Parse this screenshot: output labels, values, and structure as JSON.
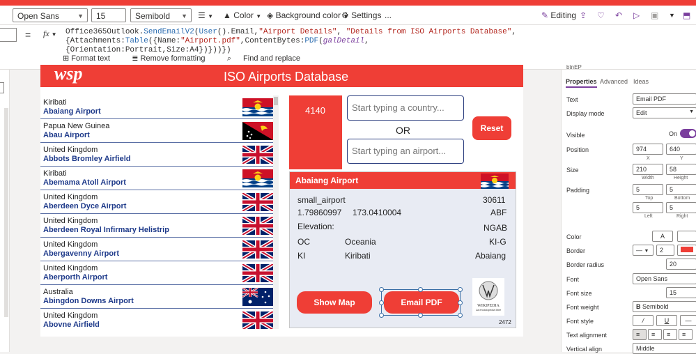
{
  "toolbar": {
    "font": "Open Sans",
    "font_size": "15",
    "font_weight": "Semibold",
    "color_label": "Color",
    "bg_color_label": "Background color",
    "settings_label": "Settings",
    "more_label": "...",
    "editing_label": "Editing"
  },
  "formula": {
    "prop": "=",
    "fx": "fx",
    "p1": "Office365Outlook.",
    "f1": "SendEmailV2",
    "p2": "(",
    "f2": "User",
    "p3": "().Email,",
    "s1": "\"Airport Details\"",
    "p4": ", ",
    "s2": "\"Details from ISO Airports Database\"",
    "p5": ",{Attachments:",
    "f3": "Table",
    "p6": "({Name:",
    "s3": "\"Airport.pdf\"",
    "p7": ",ContentBytes:",
    "f4": "PDF",
    "p8": "(",
    "i1": "galDetail",
    "p9": ",",
    "line2": "{Orientation:Portrait,Size:A4})}))})",
    "format_text": "Format text",
    "remove_formatting": "Remove formatting",
    "find_replace": "Find and replace"
  },
  "app": {
    "title": "ISO Airports Database",
    "logo": "wsp",
    "count": "4140",
    "country_placeholder": "Start typing a country...",
    "or_label": "OR",
    "airport_placeholder": "Start typing an airport...",
    "reset_label": "Reset"
  },
  "airports": [
    {
      "country": "Kiribati",
      "name": "Abaiang Airport",
      "flag": "kiribati-flag"
    },
    {
      "country": "Papua New Guinea",
      "name": "Abau Airport",
      "flag": "png-flag"
    },
    {
      "country": "United Kingdom",
      "name": "Abbots Bromley Airfield",
      "flag": "uk-flag"
    },
    {
      "country": "Kiribati",
      "name": "Abemama Atoll Airport",
      "flag": "kiribati-flag"
    },
    {
      "country": "United Kingdom",
      "name": "Aberdeen Dyce Airport",
      "flag": "uk-flag"
    },
    {
      "country": "United Kingdom",
      "name": "Aberdeen Royal Infirmary Helistrip",
      "flag": "uk-flag"
    },
    {
      "country": "United Kingdom",
      "name": "Abergavenny Airport",
      "flag": "uk-flag"
    },
    {
      "country": "United Kingdom",
      "name": "Aberporth Airport",
      "flag": "uk-flag"
    },
    {
      "country": "Australia",
      "name": "Abingdon Downs Airport",
      "flag": "australia-flag"
    },
    {
      "country": "United Kingdom",
      "name": "Abovne Airfield",
      "flag": "uk-flag"
    }
  ],
  "detail": {
    "name": "Abaiang Airport",
    "type": "small_airport",
    "id": "30611",
    "lat": "1.79860997",
    "lon": "173.0410004",
    "iata": "ABF",
    "elevation_label": "Elevation:",
    "ident": "NGAB",
    "continent": "OC",
    "continent_name": "Oceania",
    "region": "KI-G",
    "country_code": "KI",
    "country": "Kiribati",
    "municipality": "Abaiang",
    "show_map": "Show Map",
    "email_pdf": "Email PDF",
    "wiki_label": "WIKIPEDIA",
    "wiki_sub": "La enciclopedia libre",
    "small_number": "2472"
  },
  "props": {
    "top_cut": "btnEP",
    "tab_properties": "Properties",
    "tab_advanced": "Advanced",
    "tab_ideas": "Ideas",
    "text_label": "Text",
    "text_value": "Email PDF",
    "display_mode_label": "Display mode",
    "display_mode_value": "Edit",
    "visible_label": "Visible",
    "visible_value": "On",
    "position_label": "Position",
    "pos_x": "974",
    "pos_y": "640",
    "x_label": "X",
    "y_label": "Y",
    "size_label": "Size",
    "width": "210",
    "height": "58",
    "width_label": "Width",
    "height_label": "Height",
    "padding_label": "Padding",
    "pad_top": "5",
    "pad_bottom": "5",
    "pad_left": "5",
    "pad_right": "5",
    "top_label": "Top",
    "bottom_label": "Bottom",
    "left_label": "Left",
    "right_label": "Right",
    "color_label": "Color",
    "color_glyph": "A",
    "border_label": "Border",
    "border_width": "2",
    "border_radius_label": "Border radius",
    "border_radius": "20",
    "font_label": "Font",
    "font_value": "Open Sans",
    "font_size_label": "Font size",
    "font_size": "15",
    "font_weight_label": "Font weight",
    "font_weight": "Semibold",
    "font_weight_glyph": "B",
    "font_style_label": "Font style",
    "text_align_label": "Text alignment",
    "vertical_align_label": "Vertical align",
    "vertical_align": "Middle"
  },
  "colors": {
    "accent": "#ef3e36",
    "navy": "#1e3a8a"
  }
}
